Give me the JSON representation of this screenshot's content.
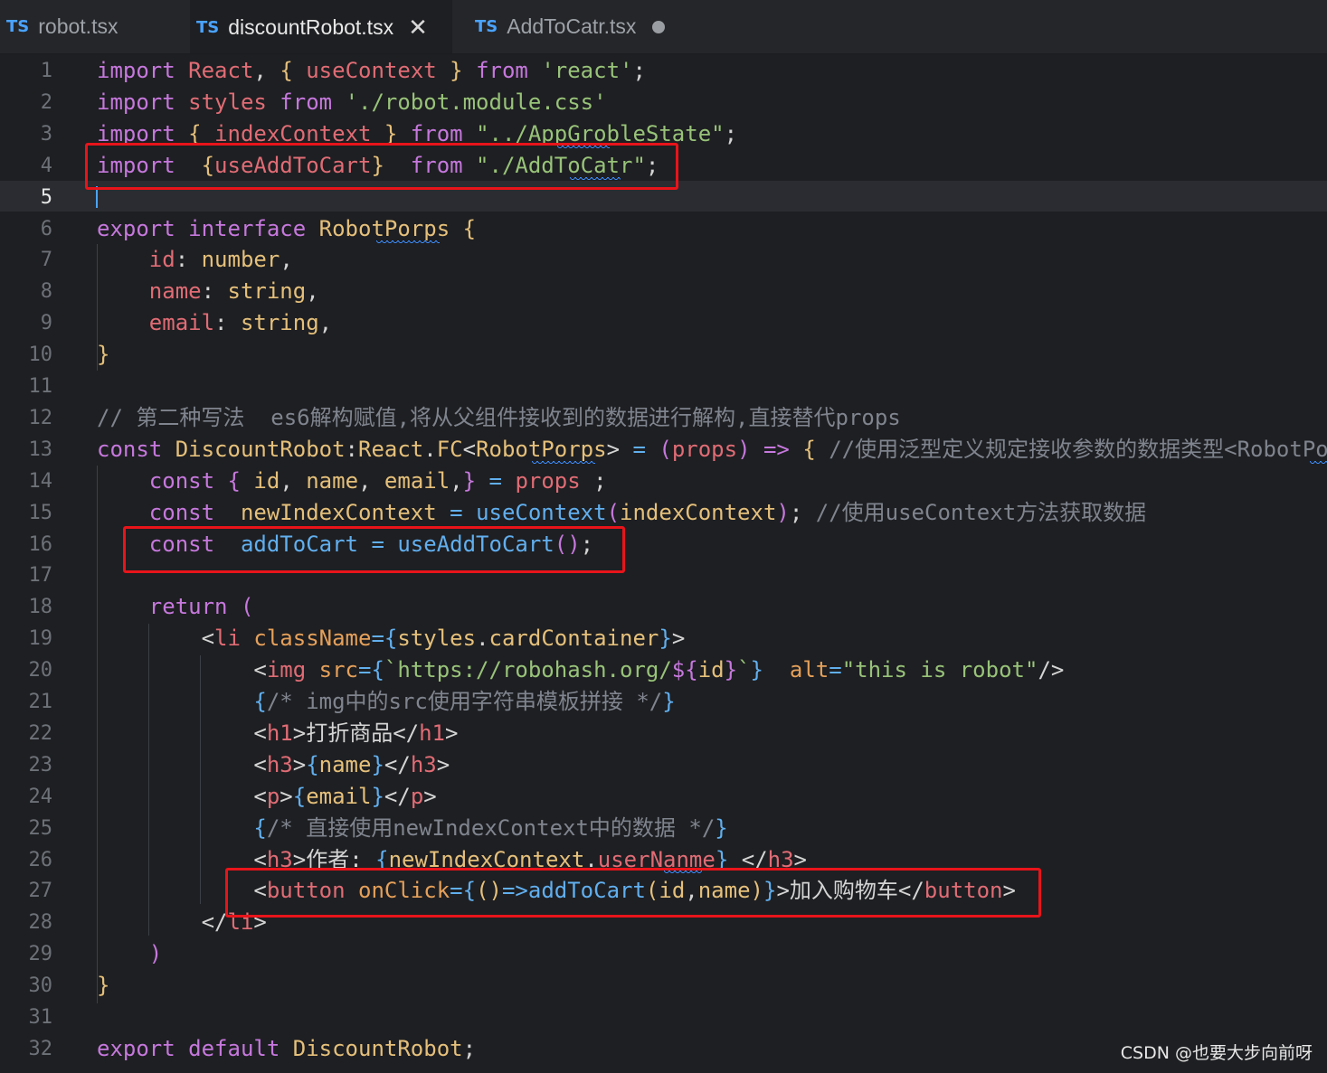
{
  "tabs": [
    {
      "lang": "TS",
      "label": "robot.tsx"
    },
    {
      "lang": "TS",
      "label": "discountRobot.tsx",
      "close": "✕"
    },
    {
      "lang": "TS",
      "label": "AddToCatr.tsx"
    }
  ],
  "editor": {
    "current_line": 5,
    "lines": [
      {
        "n": "1",
        "spans": [
          [
            "k",
            "import "
          ],
          [
            "r",
            "React"
          ],
          [
            "p",
            ", "
          ],
          [
            "br1",
            "{ "
          ],
          [
            "r",
            "useContext"
          ],
          [
            "br1",
            " }"
          ],
          [
            "k",
            " from "
          ],
          [
            "s",
            "'react'"
          ],
          [
            "p",
            ";"
          ]
        ]
      },
      {
        "n": "2",
        "spans": [
          [
            "k",
            "import "
          ],
          [
            "r",
            "styles"
          ],
          [
            "k",
            " from "
          ],
          [
            "s",
            "'./robot.module.css'"
          ]
        ]
      },
      {
        "n": "3",
        "spans": [
          [
            "k",
            "import "
          ],
          [
            "br1",
            "{ "
          ],
          [
            "r",
            "indexContext"
          ],
          [
            "br1",
            " }"
          ],
          [
            "k",
            " from "
          ],
          [
            "s",
            "\"../AppGrobleState\""
          ],
          [
            "p",
            ";"
          ]
        ]
      },
      {
        "n": "4",
        "spans": [
          [
            "k",
            "import  "
          ],
          [
            "br1",
            "{"
          ],
          [
            "r",
            "useAddToCart"
          ],
          [
            "br1",
            "}"
          ],
          [
            "k",
            "  from "
          ],
          [
            "s",
            "\"./AddToCatr\""
          ],
          [
            "p",
            ";"
          ]
        ]
      },
      {
        "n": "5",
        "spans": []
      },
      {
        "n": "6",
        "spans": [
          [
            "k",
            "export "
          ],
          [
            "k",
            "interface "
          ],
          [
            "y",
            "RobotPorps "
          ],
          [
            "br1",
            "{"
          ]
        ]
      },
      {
        "n": "7",
        "spans": [
          [
            "p",
            "    "
          ],
          [
            "r",
            "id"
          ],
          [
            "p",
            ": "
          ],
          [
            "y",
            "number"
          ],
          [
            "p",
            ","
          ]
        ]
      },
      {
        "n": "8",
        "spans": [
          [
            "p",
            "    "
          ],
          [
            "r",
            "name"
          ],
          [
            "p",
            ": "
          ],
          [
            "y",
            "string"
          ],
          [
            "p",
            ","
          ]
        ]
      },
      {
        "n": "9",
        "spans": [
          [
            "p",
            "    "
          ],
          [
            "r",
            "email"
          ],
          [
            "p",
            ": "
          ],
          [
            "y",
            "string"
          ],
          [
            "p",
            ","
          ]
        ]
      },
      {
        "n": "10",
        "spans": [
          [
            "br1",
            "}"
          ]
        ]
      },
      {
        "n": "11",
        "spans": []
      },
      {
        "n": "12",
        "spans": [
          [
            "c",
            "// 第二种写法  es6解构赋值,将从父组件接收到的数据进行解构,直接替代props"
          ]
        ]
      },
      {
        "n": "13",
        "spans": [
          [
            "k",
            "const "
          ],
          [
            "y",
            "DiscountRobot"
          ],
          [
            "p",
            ":"
          ],
          [
            "y",
            "React"
          ],
          [
            "p",
            "."
          ],
          [
            "y",
            "FC"
          ],
          [
            "p",
            "<"
          ],
          [
            "y",
            "RobotPorps"
          ],
          [
            "p",
            "> "
          ],
          [
            "b",
            "= "
          ],
          [
            "br2",
            "("
          ],
          [
            "r",
            "props"
          ],
          [
            "br2",
            ")"
          ],
          [
            "k",
            " => "
          ],
          [
            "br1",
            "{ "
          ],
          [
            "c",
            "//使用泛型定义规定接收参数的数据类型<RobotPorps>"
          ]
        ]
      },
      {
        "n": "14",
        "spans": [
          [
            "p",
            "    "
          ],
          [
            "k",
            "const "
          ],
          [
            "br2",
            "{ "
          ],
          [
            "y",
            "id"
          ],
          [
            "p",
            ", "
          ],
          [
            "y",
            "name"
          ],
          [
            "p",
            ", "
          ],
          [
            "y",
            "email"
          ],
          [
            "p",
            ","
          ],
          [
            "br2",
            "}"
          ],
          [
            "b",
            " = "
          ],
          [
            "r",
            "props"
          ],
          [
            "p",
            " ;"
          ]
        ]
      },
      {
        "n": "15",
        "spans": [
          [
            "p",
            "    "
          ],
          [
            "k",
            "const  "
          ],
          [
            "y",
            "newIndexContext"
          ],
          [
            "b",
            " = "
          ],
          [
            "b",
            "useContext"
          ],
          [
            "br2",
            "("
          ],
          [
            "y",
            "indexContext"
          ],
          [
            "br2",
            ")"
          ],
          [
            "p",
            "; "
          ],
          [
            "c",
            "//使用useContext方法获取数据"
          ]
        ]
      },
      {
        "n": "16",
        "spans": [
          [
            "p",
            "    "
          ],
          [
            "k",
            "const  "
          ],
          [
            "b",
            "addToCart"
          ],
          [
            "b",
            " = "
          ],
          [
            "b",
            "useAddToCart"
          ],
          [
            "br2",
            "()"
          ],
          [
            "p",
            ";"
          ]
        ]
      },
      {
        "n": "17",
        "spans": []
      },
      {
        "n": "18",
        "spans": [
          [
            "p",
            "    "
          ],
          [
            "k",
            "return "
          ],
          [
            "br2",
            "("
          ]
        ]
      },
      {
        "n": "19",
        "spans": [
          [
            "p",
            "        <"
          ],
          [
            "r",
            "li "
          ],
          [
            "o",
            "className"
          ],
          [
            "b",
            "="
          ],
          [
            "br3",
            "{"
          ],
          [
            "y",
            "styles"
          ],
          [
            "p",
            "."
          ],
          [
            "y",
            "cardContainer"
          ],
          [
            "br3",
            "}"
          ],
          [
            "p",
            ">"
          ]
        ]
      },
      {
        "n": "20",
        "spans": [
          [
            "p",
            "            <"
          ],
          [
            "r",
            "img "
          ],
          [
            "o",
            "src"
          ],
          [
            "b",
            "="
          ],
          [
            "br3",
            "{"
          ],
          [
            "s",
            "`https://robohash.org/"
          ],
          [
            "k",
            "${"
          ],
          [
            "y",
            "id"
          ],
          [
            "k",
            "}"
          ],
          [
            "s",
            "`"
          ],
          [
            "br3",
            "}"
          ],
          [
            "p",
            "  "
          ],
          [
            "o",
            "alt"
          ],
          [
            "b",
            "="
          ],
          [
            "s",
            "\"this is robot\""
          ],
          [
            "p",
            "/>"
          ]
        ]
      },
      {
        "n": "21",
        "spans": [
          [
            "p",
            "            "
          ],
          [
            "br3",
            "{"
          ],
          [
            "c",
            "/* img中的src使用字符串模板拼接 */"
          ],
          [
            "br3",
            "}"
          ]
        ]
      },
      {
        "n": "22",
        "spans": [
          [
            "p",
            "            <"
          ],
          [
            "r",
            "h1"
          ],
          [
            "p",
            ">打折商品</"
          ],
          [
            "r",
            "h1"
          ],
          [
            "p",
            ">"
          ]
        ]
      },
      {
        "n": "23",
        "spans": [
          [
            "p",
            "            <"
          ],
          [
            "r",
            "h3"
          ],
          [
            "p",
            ">"
          ],
          [
            "br3",
            "{"
          ],
          [
            "y",
            "name"
          ],
          [
            "br3",
            "}"
          ],
          [
            "p",
            "</"
          ],
          [
            "r",
            "h3"
          ],
          [
            "p",
            ">"
          ]
        ]
      },
      {
        "n": "24",
        "spans": [
          [
            "p",
            "            <"
          ],
          [
            "r",
            "p"
          ],
          [
            "p",
            ">"
          ],
          [
            "br3",
            "{"
          ],
          [
            "y",
            "email"
          ],
          [
            "br3",
            "}"
          ],
          [
            "p",
            "</"
          ],
          [
            "r",
            "p"
          ],
          [
            "p",
            ">"
          ]
        ]
      },
      {
        "n": "25",
        "spans": [
          [
            "p",
            "            "
          ],
          [
            "br3",
            "{"
          ],
          [
            "c",
            "/* 直接使用newIndexContext中的数据 */"
          ],
          [
            "br3",
            "}"
          ]
        ]
      },
      {
        "n": "26",
        "spans": [
          [
            "p",
            "            <"
          ],
          [
            "r",
            "h3"
          ],
          [
            "p",
            ">作者: "
          ],
          [
            "br3",
            "{"
          ],
          [
            "y",
            "newIndexContext"
          ],
          [
            "p",
            "."
          ],
          [
            "r",
            "userNanme"
          ],
          [
            "br3",
            "}"
          ],
          [
            "p",
            " </"
          ],
          [
            "r",
            "h3"
          ],
          [
            "p",
            ">"
          ]
        ]
      },
      {
        "n": "27",
        "spans": [
          [
            "p",
            "            <"
          ],
          [
            "r",
            "button "
          ],
          [
            "o",
            "onClick"
          ],
          [
            "b",
            "="
          ],
          [
            "br3",
            "{"
          ],
          [
            "br1",
            "()"
          ],
          [
            "b",
            "=>"
          ],
          [
            "b",
            "addToCart"
          ],
          [
            "br1",
            "("
          ],
          [
            "y",
            "id"
          ],
          [
            "p",
            ","
          ],
          [
            "y",
            "name"
          ],
          [
            "br1",
            ")"
          ],
          [
            "br3",
            "}"
          ],
          [
            "p",
            ">加入购物车</"
          ],
          [
            "r",
            "button"
          ],
          [
            "p",
            ">"
          ]
        ]
      },
      {
        "n": "28",
        "spans": [
          [
            "p",
            "        </"
          ],
          [
            "r",
            "li"
          ],
          [
            "p",
            ">"
          ]
        ]
      },
      {
        "n": "29",
        "spans": [
          [
            "p",
            "    "
          ],
          [
            "br2",
            ")"
          ]
        ]
      },
      {
        "n": "30",
        "spans": [
          [
            "br1",
            "}"
          ]
        ]
      },
      {
        "n": "31",
        "spans": []
      },
      {
        "n": "32",
        "spans": [
          [
            "k",
            "export "
          ],
          [
            "k",
            "default "
          ],
          [
            "y",
            "DiscountRobot"
          ],
          [
            "p",
            ";"
          ]
        ]
      }
    ]
  },
  "watermark": "CSDN @也要大步向前呀",
  "colors": {
    "highlight_box": "#e8141a",
    "background": "#1e1f22",
    "accent": "#4aa3ff"
  }
}
